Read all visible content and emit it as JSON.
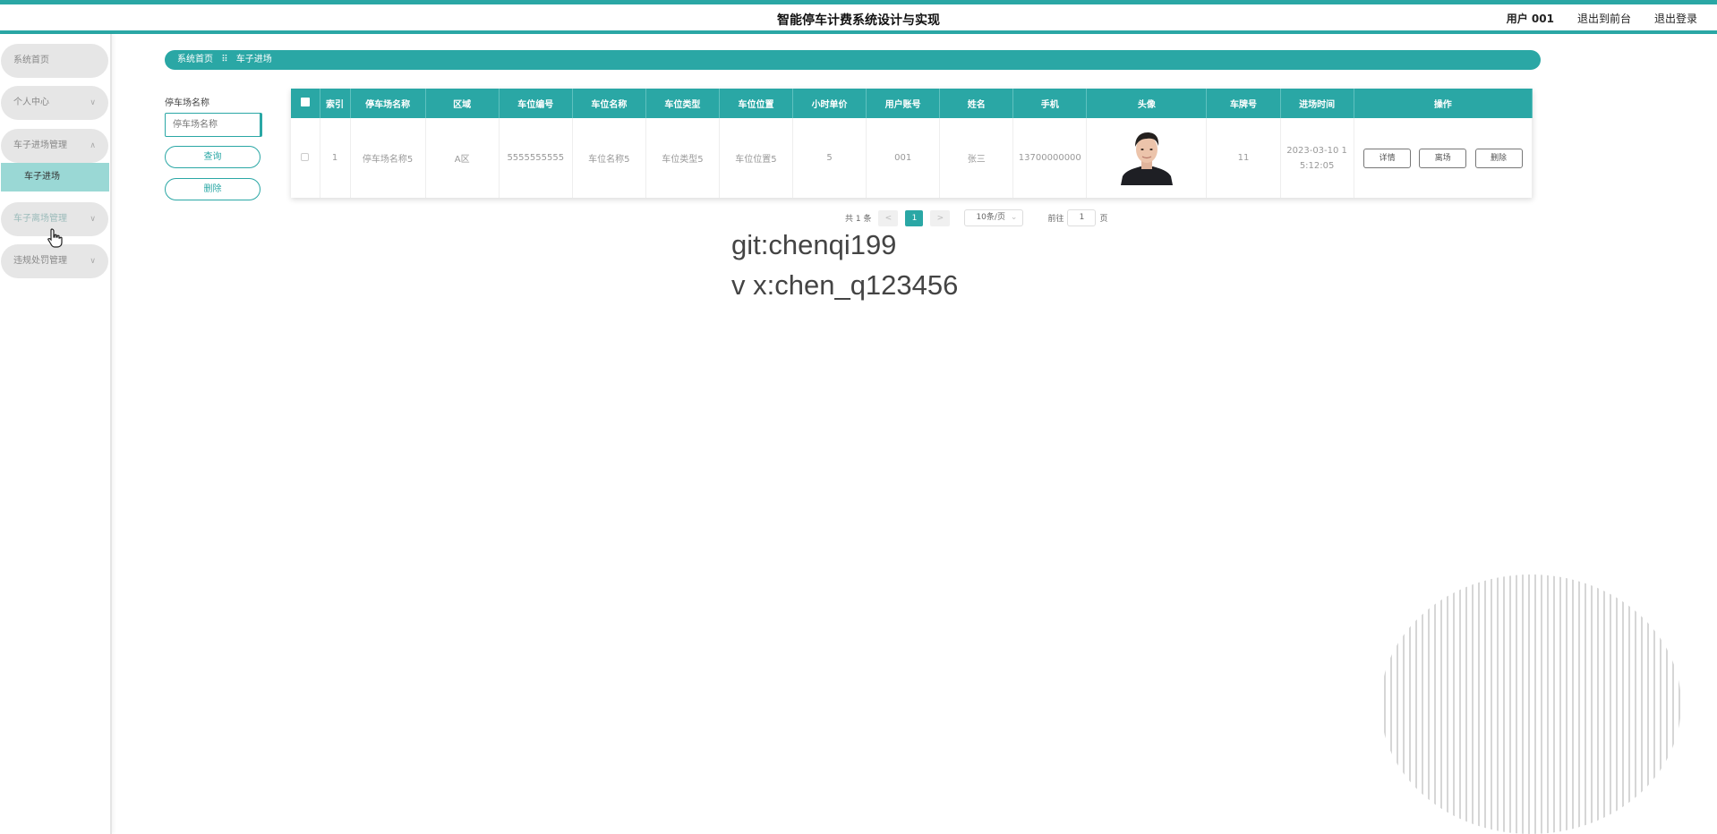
{
  "header": {
    "title": "智能停车计费系统设计与实现",
    "user": "用户 001",
    "to_frontend": "退出到前台",
    "logout": "退出登录"
  },
  "sidebar": {
    "items": [
      {
        "label": "系统首页"
      },
      {
        "label": "个人中心",
        "chevron": "∨"
      },
      {
        "label": "车子进场管理",
        "chevron": "∧"
      },
      {
        "label": "车子进场",
        "active": true
      },
      {
        "label": "车子离场管理",
        "chevron": "∨"
      },
      {
        "label": "违规处罚管理",
        "chevron": "∨"
      }
    ]
  },
  "breadcrumb": {
    "home": "系统首页",
    "sep": "⠿",
    "current": "车子进场"
  },
  "search": {
    "label": "停车场名称",
    "placeholder": "停车场名称",
    "query_button": "查询",
    "delete_button": "删除"
  },
  "table": {
    "headers": [
      "索引",
      "停车场名称",
      "区域",
      "车位编号",
      "车位名称",
      "车位类型",
      "车位位置",
      "小时单价",
      "用户账号",
      "姓名",
      "手机",
      "头像",
      "车牌号",
      "进场时间",
      "操作"
    ],
    "rows": [
      {
        "index": "1",
        "lot_name": "停车场名称5",
        "area": "A区",
        "space_no": "5555555555",
        "space_name": "车位名称5",
        "space_type": "车位类型5",
        "space_location": "车位位置5",
        "hourly_price": "5",
        "account": "001",
        "name": "张三",
        "phone": "13700000000",
        "plate": "11",
        "entry_time_line1": "2023-03-10 1",
        "entry_time_line2": "5:12:05",
        "actions": {
          "detail": "详情",
          "leave": "离场",
          "delete": "删除"
        }
      }
    ]
  },
  "pagination": {
    "total": "共 1 条",
    "prev": "<",
    "page": "1",
    "next": ">",
    "size": "10条/页",
    "goto": "前往",
    "goto_value": "1",
    "unit": "页"
  },
  "watermark": {
    "line1": "git:chenqi199",
    "line2": "v x:chen_q123456"
  },
  "colors": {
    "accent": "#2aa7a5",
    "active_bg": "#9ad8d5"
  }
}
